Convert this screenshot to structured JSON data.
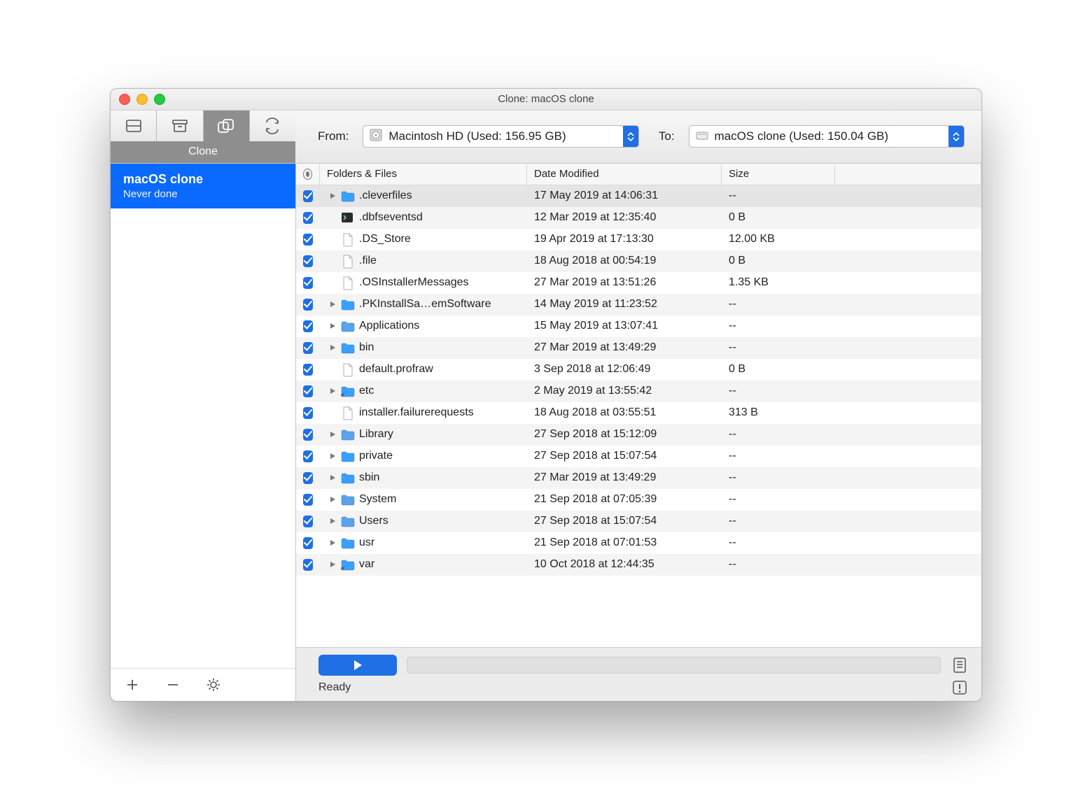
{
  "window": {
    "title": "Clone: macOS clone"
  },
  "toolbar": {
    "active_tab_label": "Clone",
    "from_label": "From:",
    "to_label": "To:",
    "from_value": "Macintosh HD (Used: 156.95 GB)",
    "to_value": "macOS clone (Used: 150.04 GB)"
  },
  "sidebar": {
    "items": [
      {
        "title": "macOS clone",
        "subtitle": "Never done",
        "selected": true
      }
    ]
  },
  "columns": {
    "name": "Folders & Files",
    "date": "Date Modified",
    "size": "Size"
  },
  "rows": [
    {
      "checked": true,
      "expandable": true,
      "kind": "folder",
      "name": ".cleverfiles",
      "date": "17 May 2019 at 14:06:31",
      "size": "--",
      "selected": true
    },
    {
      "checked": true,
      "expandable": false,
      "kind": "terminal",
      "name": ".dbfseventsd",
      "date": "12 Mar 2019 at 12:35:40",
      "size": "0 B",
      "selected": false
    },
    {
      "checked": true,
      "expandable": false,
      "kind": "file",
      "name": ".DS_Store",
      "date": "19 Apr 2019 at 17:13:30",
      "size": "12.00 KB",
      "selected": false
    },
    {
      "checked": true,
      "expandable": false,
      "kind": "file",
      "name": ".file",
      "date": "18 Aug 2018 at 00:54:19",
      "size": "0 B",
      "selected": false
    },
    {
      "checked": true,
      "expandable": false,
      "kind": "file",
      "name": ".OSInstallerMessages",
      "date": "27 Mar 2019 at 13:51:26",
      "size": "1.35 KB",
      "selected": false
    },
    {
      "checked": true,
      "expandable": true,
      "kind": "folder",
      "name": ".PKInstallSa…emSoftware",
      "date": "14 May 2019 at 11:23:52",
      "size": "--",
      "selected": false
    },
    {
      "checked": true,
      "expandable": true,
      "kind": "sysfolder",
      "name": "Applications",
      "date": "15 May 2019 at 13:07:41",
      "size": "--",
      "selected": false
    },
    {
      "checked": true,
      "expandable": true,
      "kind": "folder",
      "name": "bin",
      "date": "27 Mar 2019 at 13:49:29",
      "size": "--",
      "selected": false
    },
    {
      "checked": true,
      "expandable": false,
      "kind": "file",
      "name": "default.profraw",
      "date": "3 Sep 2018 at 12:06:49",
      "size": "0 B",
      "selected": false
    },
    {
      "checked": true,
      "expandable": true,
      "kind": "alias",
      "name": "etc",
      "date": "2 May 2019 at 13:55:42",
      "size": "--",
      "selected": false
    },
    {
      "checked": true,
      "expandable": false,
      "kind": "file",
      "name": "installer.failurerequests",
      "date": "18 Aug 2018 at 03:55:51",
      "size": "313 B",
      "selected": false
    },
    {
      "checked": true,
      "expandable": true,
      "kind": "sysfolder",
      "name": "Library",
      "date": "27 Sep 2018 at 15:12:09",
      "size": "--",
      "selected": false
    },
    {
      "checked": true,
      "expandable": true,
      "kind": "folder",
      "name": "private",
      "date": "27 Sep 2018 at 15:07:54",
      "size": "--",
      "selected": false
    },
    {
      "checked": true,
      "expandable": true,
      "kind": "folder",
      "name": "sbin",
      "date": "27 Mar 2019 at 13:49:29",
      "size": "--",
      "selected": false
    },
    {
      "checked": true,
      "expandable": true,
      "kind": "sysfolder",
      "name": "System",
      "date": "21 Sep 2018 at 07:05:39",
      "size": "--",
      "selected": false
    },
    {
      "checked": true,
      "expandable": true,
      "kind": "sysfolder",
      "name": "Users",
      "date": "27 Sep 2018 at 15:07:54",
      "size": "--",
      "selected": false
    },
    {
      "checked": true,
      "expandable": true,
      "kind": "folder",
      "name": "usr",
      "date": "21 Sep 2018 at 07:01:53",
      "size": "--",
      "selected": false
    },
    {
      "checked": true,
      "expandable": true,
      "kind": "alias",
      "name": "var",
      "date": "10 Oct 2018 at 12:44:35",
      "size": "--",
      "selected": false
    }
  ],
  "footer": {
    "status": "Ready"
  }
}
